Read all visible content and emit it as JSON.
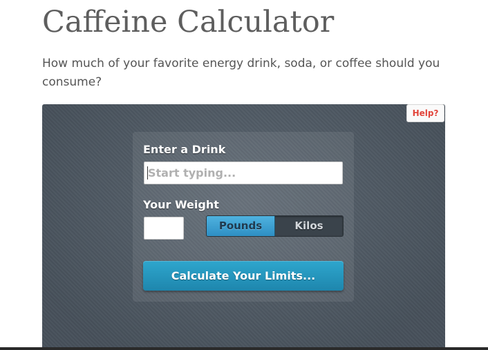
{
  "page": {
    "title": "Caffeine Calculator",
    "intro": "How much of your favorite energy drink, soda, or coffee should you consume?"
  },
  "calculator": {
    "help_label": "Help?",
    "drink": {
      "label": "Enter a Drink",
      "placeholder": "Start typing...",
      "value": ""
    },
    "weight": {
      "label": "Your Weight",
      "value": "",
      "units": [
        "Pounds",
        "Kilos"
      ],
      "selected_unit": "Pounds"
    },
    "submit_label": "Calculate Your Limits..."
  },
  "colors": {
    "panel_bg": "#515c67",
    "accent_blue": "#2e9cc8",
    "help_red": "#e2453b",
    "title_gray": "#5e5e5e"
  }
}
